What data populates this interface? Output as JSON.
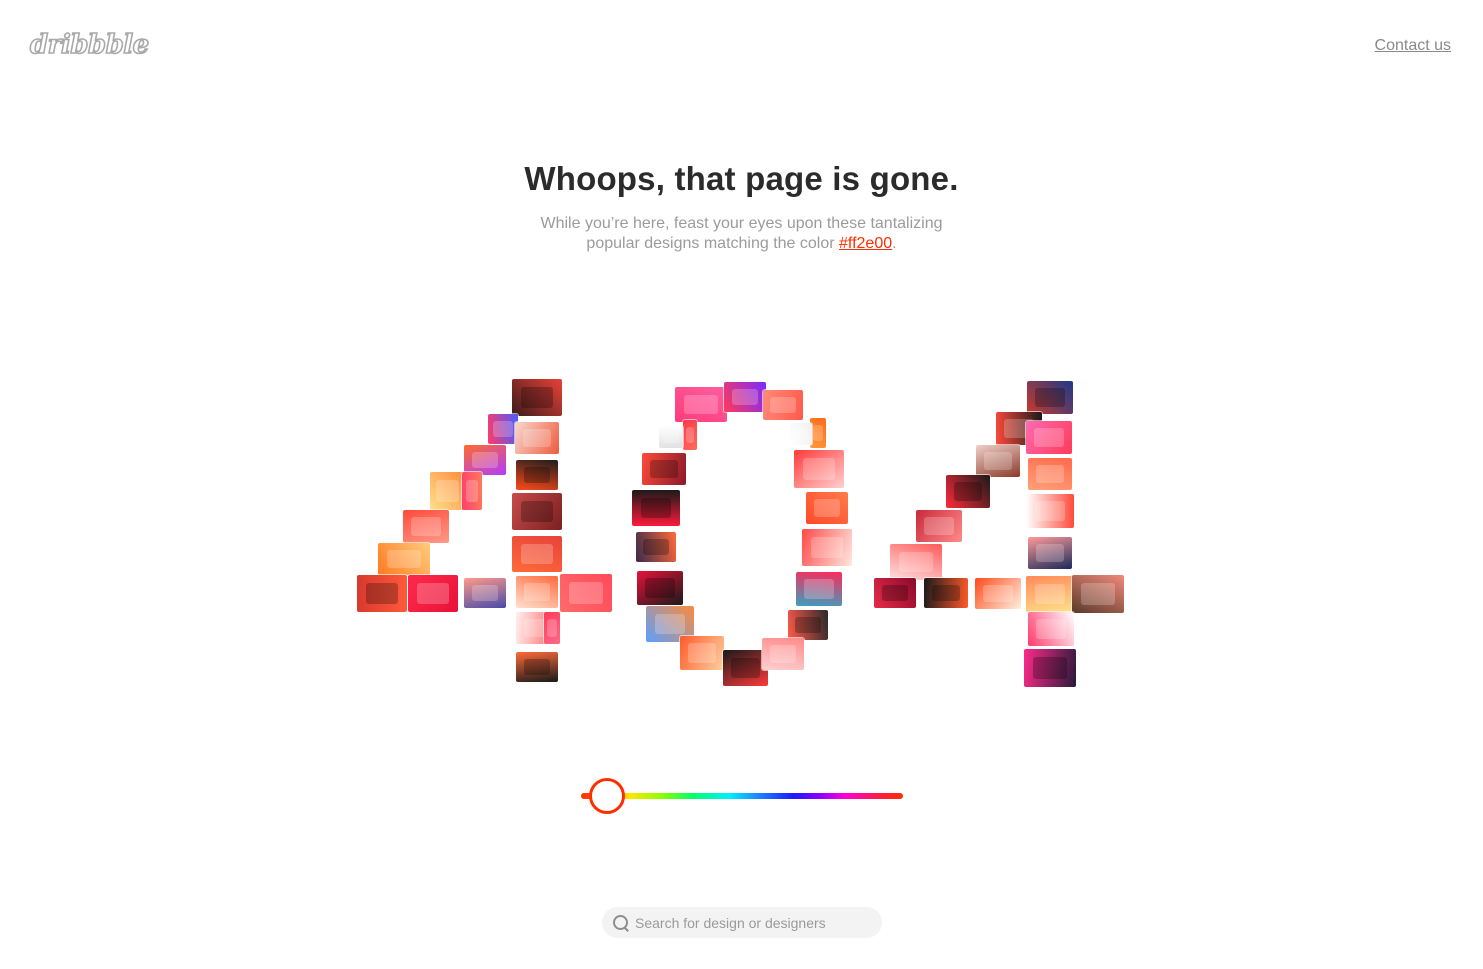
{
  "header": {
    "logo_text": "dribbble",
    "contact_label": "Contact us"
  },
  "hero": {
    "title": "Whoops, that page is gone.",
    "subtitle_before": "While you’re here, feast your eyes upon these tantalizing popular designs matching the color ",
    "color_hex": "#ff2e00",
    "subtitle_after": "."
  },
  "color_slider": {
    "selected_color": "#ff2e00",
    "position_fraction": 0.0
  },
  "search": {
    "placeholder": "Search for design or designers"
  },
  "colors": {
    "accent": "#ff2e00",
    "title": "#2b2b2b",
    "muted": "#9b9b9b"
  }
}
